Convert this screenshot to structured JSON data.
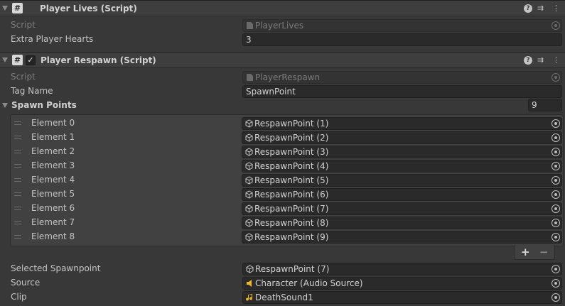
{
  "player_lives": {
    "title": "Player Lives (Script)",
    "script_label": "Script",
    "script_value": "PlayerLives",
    "hearts_label": "Extra Player Hearts",
    "hearts_value": "3"
  },
  "player_respawn": {
    "title": "Player Respawn (Script)",
    "enabled": true,
    "script_label": "Script",
    "script_value": "PlayerRespawn",
    "tag_label": "Tag Name",
    "tag_value": "SpawnPoint",
    "spawn_points_label": "Spawn Points",
    "spawn_points_count": "9",
    "elements": [
      {
        "label": "Element 0",
        "value": "RespawnPoint (1)"
      },
      {
        "label": "Element 1",
        "value": "RespawnPoint (2)"
      },
      {
        "label": "Element 2",
        "value": "RespawnPoint (3)"
      },
      {
        "label": "Element 3",
        "value": "RespawnPoint (4)"
      },
      {
        "label": "Element 4",
        "value": "RespawnPoint (5)"
      },
      {
        "label": "Element 5",
        "value": "RespawnPoint (6)"
      },
      {
        "label": "Element 6",
        "value": "RespawnPoint (7)"
      },
      {
        "label": "Element 7",
        "value": "RespawnPoint (8)"
      },
      {
        "label": "Element 8",
        "value": "RespawnPoint (9)"
      }
    ],
    "add_label": "+",
    "remove_label": "−",
    "selected_label": "Selected Spawnpoint",
    "selected_value": "RespawnPoint (7)",
    "source_label": "Source",
    "source_value": "Character (Audio Source)",
    "clip_label": "Clip",
    "clip_value": "DeathSound1"
  },
  "header_buttons": {
    "help": "?",
    "settings": "⇉",
    "more": "⋮"
  },
  "icons": {
    "script": "hash-script-icon",
    "gameobject": "cube-icon",
    "audio_source": "speaker-icon",
    "audio_clip": "music-note-icon",
    "object_picker": "target-icon"
  },
  "colors": {
    "background": "#383838",
    "header": "#3e3e3e",
    "field": "#2a2a2a",
    "audio_icon": "#f0b429"
  }
}
